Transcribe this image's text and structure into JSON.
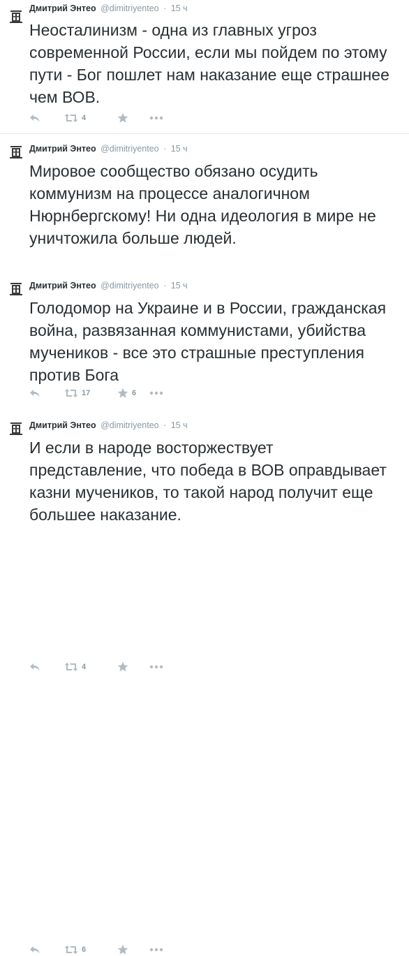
{
  "tweets": [
    {
      "fullname": "Дмитрий Энтео",
      "username": "@dimitriyenteo",
      "separator": "·",
      "time": "15 ч",
      "text": "Неосталинизм - одна из главных угроз современной России, если мы пойдем по этому пути - Бог пошлет нам наказание еще страшнее чем ВОВ.",
      "retweets": "4",
      "favorites": ""
    },
    {
      "fullname": "Дмитрий Энтео",
      "username": "@dimitriyenteo",
      "separator": "·",
      "time": "15 ч",
      "text": "Мировое сообщество обязано осудить коммунизм на процессе аналогичном Нюрнбергскому! Ни одна идеология в мире не уничтожила больше людей.",
      "retweets": "17",
      "favorites": "6"
    },
    {
      "fullname": "Дмитрий Энтео",
      "username": "@dimitriyenteo",
      "separator": "·",
      "time": "15 ч",
      "text": "Голодомор на Украине и в России, гражданская война, развязанная коммунистами, убийства мучеников - все это страшные преступления против Бога",
      "retweets": "4",
      "favorites": ""
    },
    {
      "fullname": "Дмитрий Энтео",
      "username": "@dimitriyenteo",
      "separator": "·",
      "time": "15 ч",
      "text": "И если в народе восторжествует представление, что победа в ВОВ оправдывает казни мучеников, то такой народ получит еще большее наказание.",
      "retweets": "6",
      "favorites": ""
    }
  ],
  "icons": {
    "reply": "reply-icon",
    "retweet": "retweet-icon",
    "favorite": "star-icon",
    "more": "more-icon",
    "avatar": "avatar-icon"
  },
  "colors": {
    "text": "#292f33",
    "muted": "#8899a6",
    "icon": "#b1bbc3",
    "divider": "#e1e8ed"
  }
}
